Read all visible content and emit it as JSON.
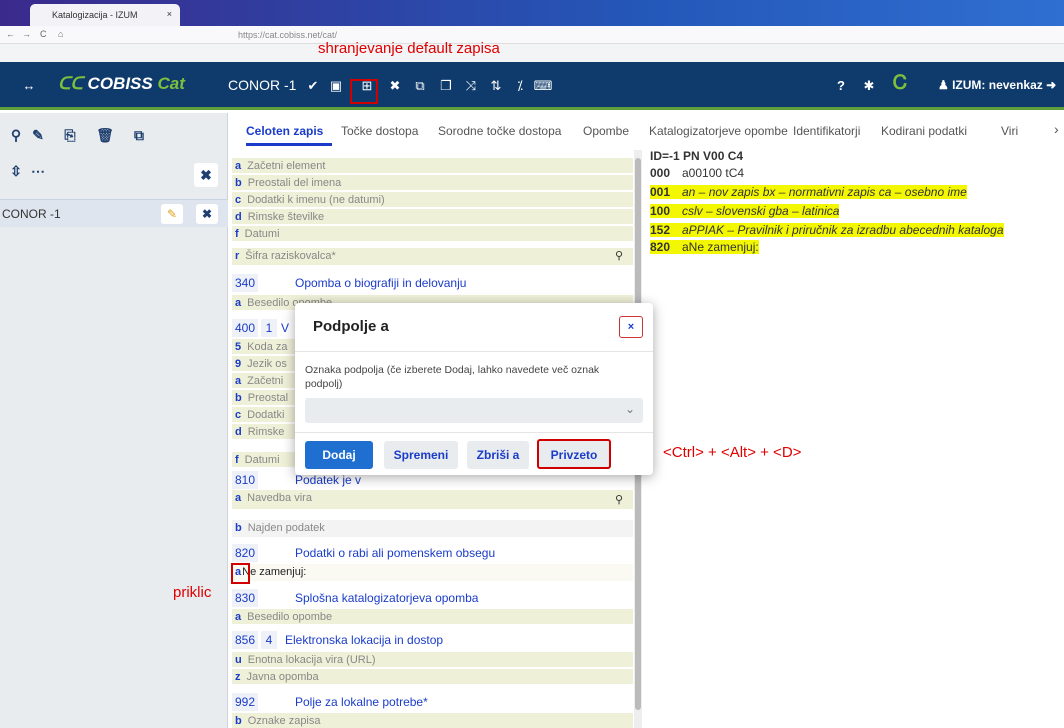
{
  "browser": {
    "tab_title": "Katalogizacija - IZUM",
    "url": "https://cat.cobiss.net/cat/"
  },
  "annotations": {
    "top": "shranjevanje default zapisa",
    "right": "<Ctrl> + <Alt> + <D>",
    "left": "priklic"
  },
  "header": {
    "logo": "COBISS",
    "logo_suffix": "Cat",
    "record_id": "CONOR -1",
    "user": "IZUM: nevenkaz"
  },
  "sidebar": {
    "record_label": "CONOR -1"
  },
  "tabs": [
    "Celoten zapis",
    "Točke dostopa",
    "Sorodne točke dostopa",
    "Opombe",
    "Katalogizatorjeve opombe",
    "Identifikatorji",
    "Kodirani podatki",
    "Viri"
  ],
  "fields": {
    "r1": {
      "sf": "a",
      "label": "Začetni element"
    },
    "r2": {
      "sf": "b",
      "label": "Preostali del imena"
    },
    "r3": {
      "sf": "c",
      "label": "Dodatki k imenu (ne datumi)"
    },
    "r4": {
      "sf": "d",
      "label": "Rimske številke"
    },
    "r5": {
      "sf": "f",
      "label": "Datumi"
    },
    "r6": {
      "sf": "r",
      "label": "Šifra raziskovalca*"
    },
    "h340": {
      "tag": "340",
      "label": "Opomba o biografiji in delovanju"
    },
    "r7": {
      "sf": "a",
      "label": "Besedilo opombe"
    },
    "h400": {
      "tag": "400",
      "ind": "1",
      "label": "V"
    },
    "r8": {
      "sf": "5",
      "label": "Koda za"
    },
    "r9": {
      "sf": "9",
      "label": "Jezik os"
    },
    "r10": {
      "sf": "a",
      "label": "Začetni"
    },
    "r11": {
      "sf": "b",
      "label": "Preostal"
    },
    "r12": {
      "sf": "c",
      "label": "Dodatki"
    },
    "r13": {
      "sf": "d",
      "label": "Rimske"
    },
    "r14": {
      "sf": "f",
      "label": "Datumi"
    },
    "h810": {
      "tag": "810",
      "label": "Podatek je v"
    },
    "r15": {
      "sf": "a",
      "label": "Navedba vira"
    },
    "r16": {
      "sf": "b",
      "label": "Najden podatek"
    },
    "h820": {
      "tag": "820",
      "label": "Podatki o rabi ali pomenskem obsegu"
    },
    "r17": {
      "sf": "a",
      "label": "Ne zamenjuj:"
    },
    "h830": {
      "tag": "830",
      "label": "Splošna katalogizatorjeva opomba"
    },
    "r18": {
      "sf": "a",
      "label": "Besedilo opombe"
    },
    "h856": {
      "tag": "856",
      "ind": "4",
      "label": "Elektronska lokacija in dostop"
    },
    "r19": {
      "sf": "u",
      "label": "Enotna lokacija vira (URL)"
    },
    "r20": {
      "sf": "z",
      "label": "Javna opomba"
    },
    "h992": {
      "tag": "992",
      "label": "Polje za lokalne potrebe*"
    },
    "r21": {
      "sf": "b",
      "label": "Oznake zapisa"
    }
  },
  "record": {
    "id_line": "ID=-1 PN V00 C4",
    "l000": {
      "tag": "000",
      "text": "a00100 tC4"
    },
    "l001": {
      "tag": "001",
      "text": "an – nov zapis bx – normativni zapis ca – osebno ime"
    },
    "l100": {
      "tag": "100",
      "text": "cslv – slovenski gba – latinica"
    },
    "l152": {
      "tag": "152",
      "text": "aPPIAK – Pravilnik i priručnik za izradbu abecednih kataloga"
    },
    "l820": {
      "tag": "820",
      "text": "aNe zamenjuj:"
    }
  },
  "modal": {
    "title": "Podpolje a",
    "field_label": "Oznaka podpolja (če izberete Dodaj, lahko navedete več oznak podpolj)",
    "close": "×",
    "buttons": {
      "add": "Dodaj",
      "change": "Spremeni",
      "delete": "Zbriši a",
      "default": "Privzeto"
    }
  },
  "colors": {
    "header_bg": "#0f3b6c",
    "accent_green": "#5f9e3c",
    "highlight": "#f3f700",
    "subfield_blue": "#1a3cc8",
    "annotation_red": "#e00000"
  }
}
